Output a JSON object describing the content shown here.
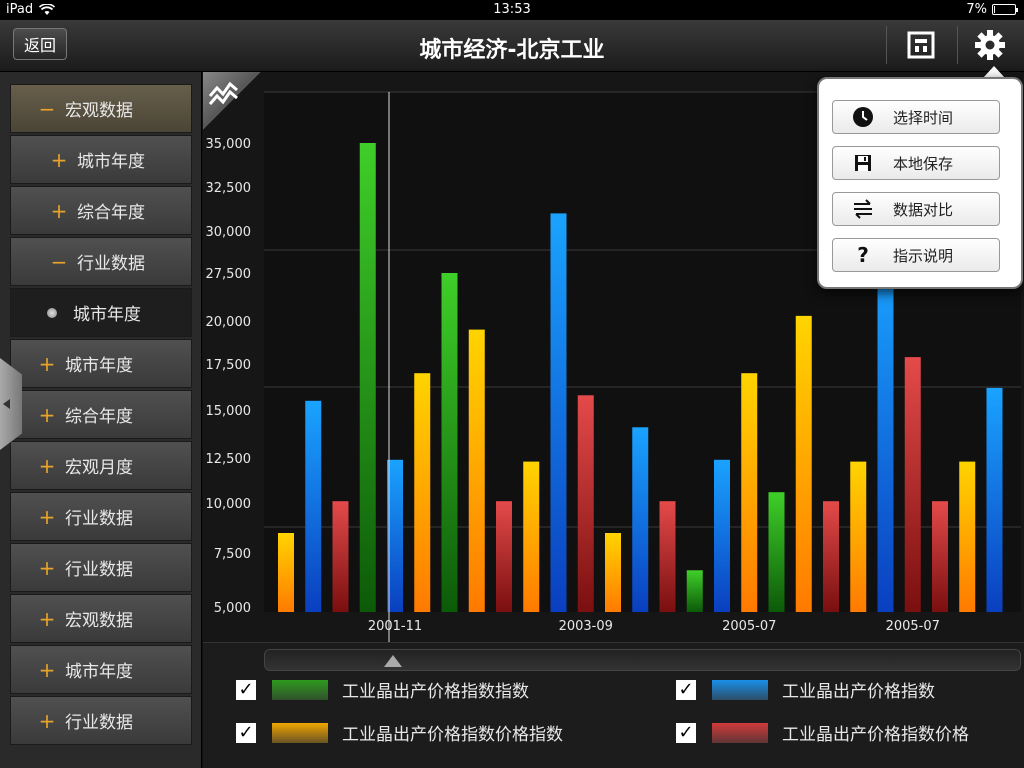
{
  "status_bar": {
    "device": "iPad",
    "time": "13:53",
    "battery_text": "7%",
    "battery_level": 0.07
  },
  "navbar": {
    "back_label": "返回",
    "title": "城市经济-北京工业"
  },
  "sidebar": {
    "items": [
      {
        "mark": "−",
        "label": "宏观数据",
        "state": "expanded",
        "indent": false
      },
      {
        "mark": "+",
        "label": "城市年度",
        "state": "normal",
        "indent": true
      },
      {
        "mark": "+",
        "label": "综合年度",
        "state": "normal",
        "indent": true
      },
      {
        "mark": "−",
        "label": "行业数据",
        "state": "normal",
        "indent": true
      },
      {
        "mark": "•",
        "label": "城市年度",
        "state": "active",
        "indent": true
      },
      {
        "mark": "+",
        "label": "城市年度",
        "state": "normal",
        "indent": false
      },
      {
        "mark": "+",
        "label": "综合年度",
        "state": "normal",
        "indent": false
      },
      {
        "mark": "+",
        "label": "宏观月度",
        "state": "normal",
        "indent": false
      },
      {
        "mark": "+",
        "label": "行业数据",
        "state": "normal",
        "indent": false
      },
      {
        "mark": "+",
        "label": "行业数据",
        "state": "normal",
        "indent": false
      },
      {
        "mark": "+",
        "label": "宏观数据",
        "state": "normal",
        "indent": false
      },
      {
        "mark": "+",
        "label": "城市年度",
        "state": "normal",
        "indent": false
      },
      {
        "mark": "+",
        "label": "行业数据",
        "state": "normal",
        "indent": false
      }
    ]
  },
  "popup": {
    "items": [
      {
        "label": "选择时间",
        "icon": "clock-icon"
      },
      {
        "label": "本地保存",
        "icon": "save-icon"
      },
      {
        "label": "数据对比",
        "icon": "compare-icon"
      },
      {
        "label": "指示说明",
        "icon": "help-icon"
      }
    ]
  },
  "legend": [
    {
      "label": "工业晶出产价格指数指数",
      "color": "#2e9a1e",
      "checked": true
    },
    {
      "label": "工业晶出产价格指数",
      "color": "#1a8fe8",
      "checked": true
    },
    {
      "label": "工业晶出产价格指数价格指数",
      "color": "#f0a500",
      "checked": true
    },
    {
      "label": "工业晶出产价格指数价格",
      "color": "#d23a3a",
      "checked": true
    }
  ],
  "chart_data": {
    "type": "bar",
    "y_ticks": [
      "5,000",
      "7,500",
      "10,000",
      "12,500",
      "15,000",
      "17,500",
      "20,000",
      "27,500",
      "30,000",
      "32,500",
      "35,000"
    ],
    "x_ticks": [
      {
        "label": "2001-11",
        "bar_index": 4
      },
      {
        "label": "2003-09",
        "bar_index": 11
      },
      {
        "label": "2005-07",
        "bar_index": 17
      },
      {
        "label": "2005-07",
        "bar_index": 23
      }
    ],
    "cursor_bar_index": 4,
    "bars": [
      {
        "series": "yellow",
        "value": 8500
      },
      {
        "series": "blue",
        "value": 15500
      },
      {
        "series": "red",
        "value": 10100
      },
      {
        "series": "green",
        "value": 35000
      },
      {
        "series": "blue",
        "value": 12400
      },
      {
        "series": "yellow",
        "value": 17000
      },
      {
        "series": "green",
        "value": 27500
      },
      {
        "series": "yellow",
        "value": 19500
      },
      {
        "series": "red",
        "value": 10100
      },
      {
        "series": "yellow",
        "value": 12300
      },
      {
        "series": "blue",
        "value": 31000
      },
      {
        "series": "red",
        "value": 15800
      },
      {
        "series": "yellow",
        "value": 8500
      },
      {
        "series": "blue",
        "value": 14100
      },
      {
        "series": "red",
        "value": 10100
      },
      {
        "series": "green",
        "value": 6700
      },
      {
        "series": "blue",
        "value": 12400
      },
      {
        "series": "yellow",
        "value": 17000
      },
      {
        "series": "green",
        "value": 10600
      },
      {
        "series": "yellow",
        "value": 20800
      },
      {
        "series": "red",
        "value": 10100
      },
      {
        "series": "yellow",
        "value": 12300
      },
      {
        "series": "blue",
        "value": 28000
      },
      {
        "series": "red",
        "value": 17900
      },
      {
        "series": "red",
        "value": 10100
      },
      {
        "series": "yellow",
        "value": 12300
      },
      {
        "series": "blue",
        "value": 16200
      }
    ],
    "grid": true
  }
}
